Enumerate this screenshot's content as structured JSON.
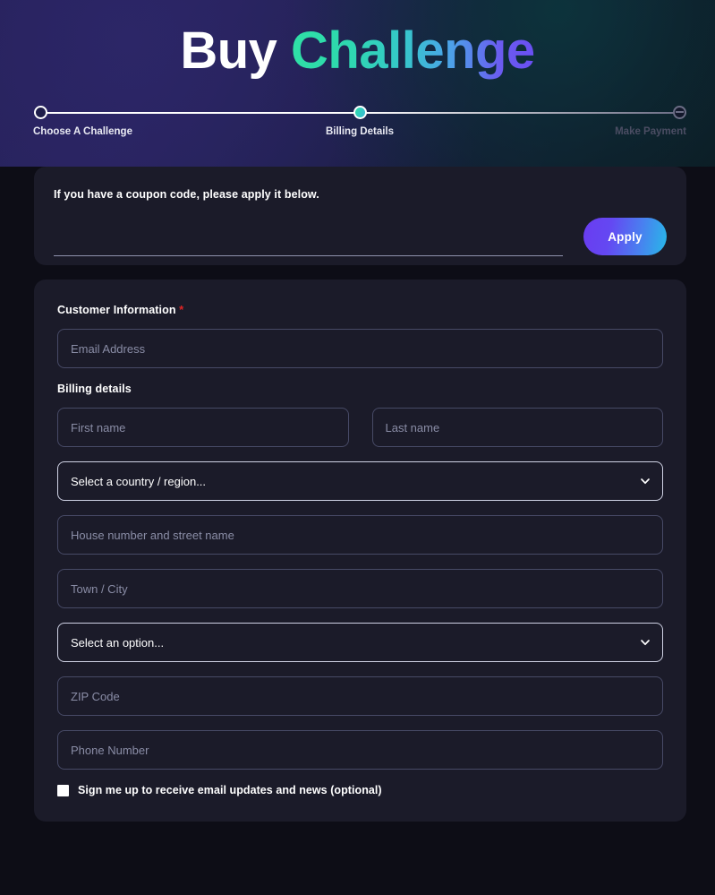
{
  "header": {
    "title_part1": "Buy",
    "title_part2": "Challenge",
    "gradient_start": "#2fe0a6",
    "gradient_end": "#6a4ff2"
  },
  "stepper": {
    "steps": [
      {
        "label": "Choose A Challenge",
        "state": "pending"
      },
      {
        "label": "Billing Details",
        "state": "active"
      },
      {
        "label": "Make Payment",
        "state": "future"
      }
    ],
    "active_color": "#2fe0a6",
    "line_color": "#ffffff",
    "dim_color": "#4b4d63"
  },
  "coupon": {
    "title": "If you have a coupon code, please apply it below.",
    "input_placeholder": "",
    "input_value": "",
    "apply_label": "Apply",
    "button_gradient_start": "#6a3cf0",
    "button_gradient_end": "#27b9e8"
  },
  "billing": {
    "customer_info_label": "Customer Information",
    "required_mark": "*",
    "required_color": "#e02424",
    "email_placeholder": "Email Address",
    "email_value": "",
    "billing_details_label": "Billing details",
    "first_name_placeholder": "First name",
    "first_name_value": "",
    "last_name_placeholder": "Last name",
    "last_name_value": "",
    "country_select_value": "Select a country / region...",
    "street_placeholder": "House number and street name",
    "street_value": "",
    "city_placeholder": "Town / City",
    "city_value": "",
    "state_select_value": "Select an option...",
    "zip_placeholder": "ZIP Code",
    "zip_value": "",
    "phone_placeholder": "Phone Number",
    "phone_value": "",
    "newsletter_label": "Sign me up to receive email updates and news (optional)",
    "newsletter_checked": false
  },
  "icons": {
    "chevron_down": "chevron-down-icon"
  }
}
